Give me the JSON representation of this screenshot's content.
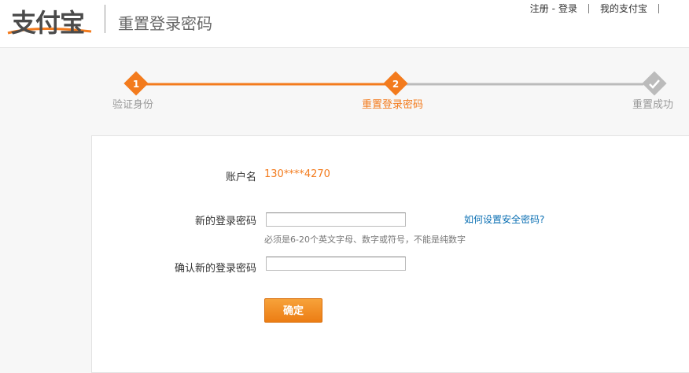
{
  "header": {
    "logo_text": "支付宝",
    "page_title": "重置登录密码",
    "links": {
      "register": "注册",
      "separator": "-",
      "login": "登录",
      "my_alipay": "我的支付宝"
    }
  },
  "steps": [
    {
      "number": "1",
      "label": "验证身份",
      "status": "done"
    },
    {
      "number": "2",
      "label": "重置登录密码",
      "status": "current"
    },
    {
      "number": "",
      "label": "重置成功",
      "status": "pending",
      "icon": "check-icon"
    }
  ],
  "form": {
    "account_label": "账户名",
    "account_value": "130****4270",
    "new_password_label": "新的登录密码",
    "new_password_value": "",
    "hint": "必须是6-20个英文字母、数字或符号，不能是纯数字",
    "help_link": "如何设置安全密码?",
    "confirm_password_label": "确认新的登录密码",
    "confirm_password_value": "",
    "submit_label": "确定"
  },
  "colors": {
    "accent": "#f37b1d",
    "link": "#0a6fb3",
    "pending": "#bbbbbb"
  }
}
